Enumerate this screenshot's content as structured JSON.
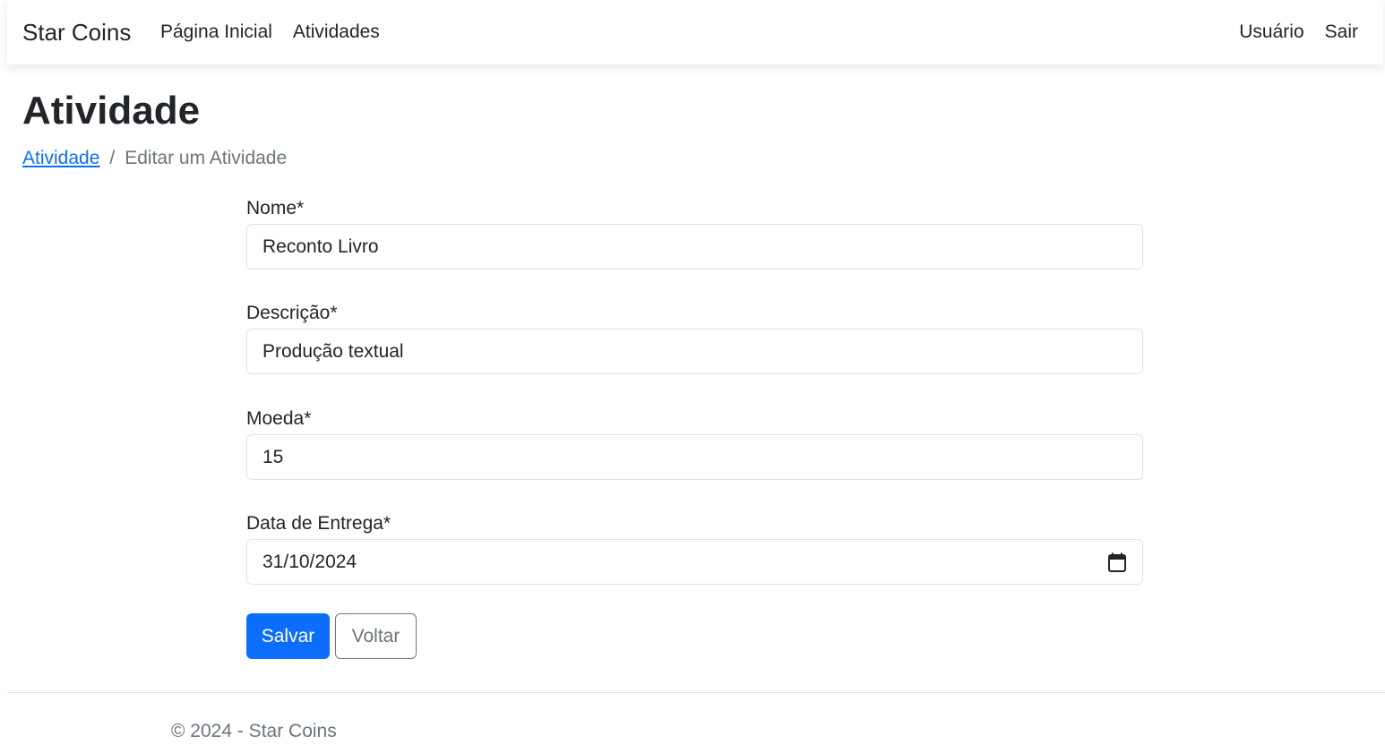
{
  "navbar": {
    "brand": "Star Coins",
    "left_links": [
      "Página Inicial",
      "Atividades"
    ],
    "right_links": [
      "Usuário",
      "Sair"
    ]
  },
  "page": {
    "title": "Atividade"
  },
  "breadcrumb": {
    "parent": "Atividade",
    "separator": "/",
    "current": "Editar um Atividade"
  },
  "form": {
    "nome": {
      "label": "Nome*",
      "value": "Reconto Livro"
    },
    "descricao": {
      "label": "Descrição*",
      "value": "Produção textual"
    },
    "moeda": {
      "label": "Moeda*",
      "value": "15"
    },
    "data_entrega": {
      "label": "Data de Entrega*",
      "value": "31/10/2024"
    }
  },
  "buttons": {
    "save_label": "Salvar",
    "back_label": "Voltar"
  },
  "footer": {
    "text": "© 2024 - Star Coins"
  },
  "colors": {
    "primary": "#0d6efd",
    "secondary": "#6c757d",
    "text": "#212529"
  },
  "icons": {
    "date_picker": "calendar-icon"
  }
}
